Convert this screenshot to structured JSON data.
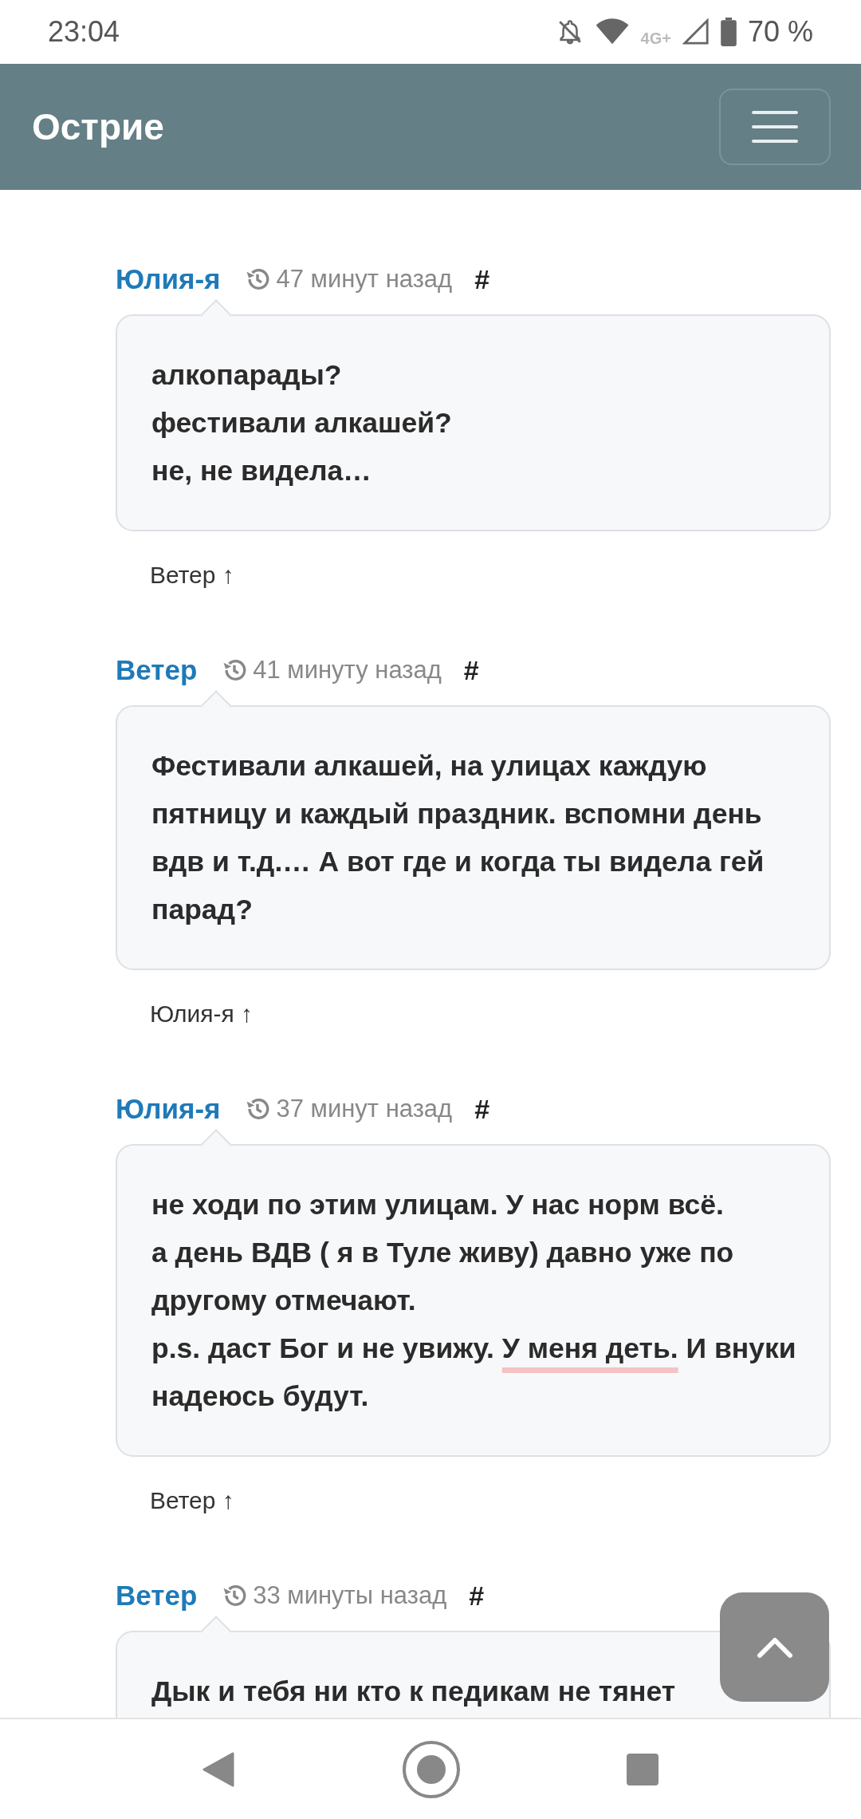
{
  "status_bar": {
    "time": "23:04",
    "network": "4G+",
    "battery": "70 %"
  },
  "app_bar": {
    "title": "Острие"
  },
  "comments": [
    {
      "author": "Юлия-я",
      "time": "47 минут назад",
      "anchor": "#",
      "lines": [
        [
          {
            "text": "алкопарады?"
          }
        ],
        [
          {
            "text": "фестивали алкашей?"
          }
        ],
        [
          {
            "text": "не, не видела…"
          }
        ]
      ],
      "reply_to": "Ветер ↑"
    },
    {
      "author": "Ветер",
      "time": "41 минуту назад",
      "anchor": "#",
      "lines": [
        [
          {
            "text": "Фестивали алкашей, на улицах каждую пятницу и каждый праздник. вспомни день вдв и т.д.… А вот где и когда ты видела гей парад?"
          }
        ]
      ],
      "reply_to": "Юлия-я ↑"
    },
    {
      "author": "Юлия-я",
      "time": "37 минут назад",
      "anchor": "#",
      "lines": [
        [
          {
            "text": "не ходи по этим улицам. У нас норм всё."
          }
        ],
        [
          {
            "text": "а день ВДВ ( я в Туле живу) давно уже по другому отмечают."
          }
        ],
        [
          {
            "text": "p.s. даст Бог и не увижу. "
          },
          {
            "text": "У меня деть.",
            "marked": true
          },
          {
            "text": " И внуки надеюсь будут."
          }
        ]
      ],
      "reply_to": "Ветер ↑"
    },
    {
      "author": "Ветер",
      "time": "33 минуты назад",
      "anchor": "#",
      "lines": [
        [
          {
            "text": "Дык и тебя ни кто к педикам не тянет"
          }
        ]
      ]
    }
  ]
}
